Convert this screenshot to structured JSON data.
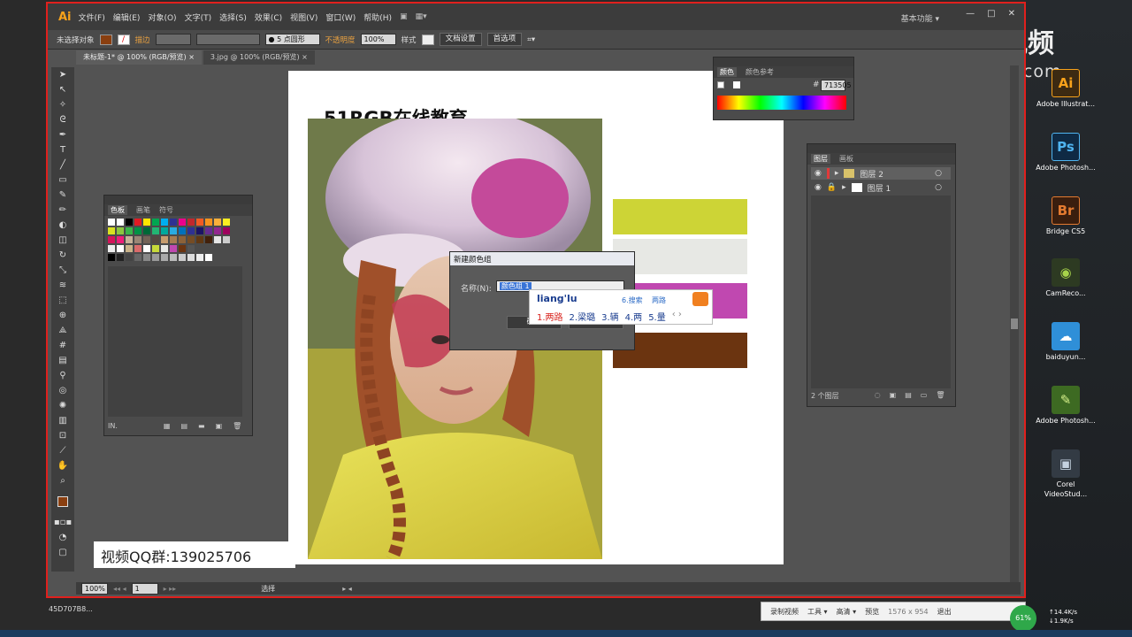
{
  "menubar": {
    "logo": "Ai",
    "items": [
      "文件(F)",
      "编辑(E)",
      "对象(O)",
      "文字(T)",
      "选择(S)",
      "效果(C)",
      "视图(V)",
      "窗口(W)",
      "帮助(H)"
    ],
    "workspace": "基本功能"
  },
  "controlbar": {
    "no_selection": "未选择对象",
    "stroke_label": "描边",
    "brush_value": "5 点圆形",
    "opacity_label": "不透明度",
    "opacity_value": "100%",
    "style_label": "样式",
    "doc_setup": "文档设置",
    "preferences": "首选项"
  },
  "tabs": [
    "未标题-1* @ 100% (RGB/预览)",
    "3.jpg @ 100% (RGB/预览)"
  ],
  "artboard": {
    "title": "51RGB在线教育",
    "blocks": [
      {
        "color": "#cdd436"
      },
      {
        "color": "#e7e8e4"
      },
      {
        "color": "#c048b0"
      },
      {
        "color": "#6b3410"
      }
    ]
  },
  "swatches_panel": {
    "tabs": [
      "色板",
      "画笔",
      "符号"
    ],
    "footer": "IN."
  },
  "color_panel": {
    "tabs": [
      "颜色",
      "颜色参考"
    ],
    "hex_label": "#",
    "hex_value": "713505"
  },
  "layers_panel": {
    "tabs": [
      "图层",
      "画板"
    ],
    "layers": [
      "图层 2",
      "图层 1"
    ],
    "footer": "2 个图层"
  },
  "dialog": {
    "title": "新建颜色组",
    "name_label": "名称(N):",
    "name_value": "颜色组 1",
    "ok": "确定",
    "cancel": "取消"
  },
  "ime": {
    "input": "liang'lu",
    "search": "6.搜索",
    "candidates": [
      "1.两路",
      "2.梁璐",
      "3.辆",
      "4.两",
      "5.量"
    ],
    "extra": "两路"
  },
  "statusbar": {
    "zoom": "100%",
    "page": "1",
    "tool": "选择"
  },
  "watermarks": {
    "sohu": "搜狐视频",
    "sohu_url": "tv.sohu.com",
    "qq_group": "视频QQ群:139025706",
    "corner": "45D707B8..."
  },
  "desktop": {
    "icons": [
      {
        "label": "Adobe Illustrat...",
        "glyph": "Ai",
        "bg": "#3c2a12",
        "fg": "#f7a21b"
      },
      {
        "label": "Adobe Photosh...",
        "glyph": "Ps",
        "bg": "#0f2a44",
        "fg": "#4fb4f0"
      },
      {
        "label": "Bridge CS5",
        "glyph": "Br",
        "bg": "#3a1e0e",
        "fg": "#e37a30"
      },
      {
        "label": "CamReco...",
        "glyph": "◉",
        "bg": "#2d3a22",
        "fg": "#a7d34a"
      },
      {
        "label": "baiduyun...",
        "glyph": "☁",
        "bg": "#2f8fd8",
        "fg": "#ffffff"
      },
      {
        "label": "Adobe Photosh...",
        "glyph": "✎",
        "bg": "#3d6a22",
        "fg": "#d6f08a"
      },
      {
        "label": "Corel VideoStud...",
        "glyph": "▣",
        "bg": "#333b44",
        "fg": "#c5d2e0"
      }
    ]
  },
  "recorder": {
    "items": [
      "录制视频",
      "工具",
      "高清",
      "预览"
    ],
    "size": "1576 x 954",
    "exit": "退出",
    "pct": "61%",
    "up": "14.4K/s",
    "down": "1.9K/s"
  }
}
